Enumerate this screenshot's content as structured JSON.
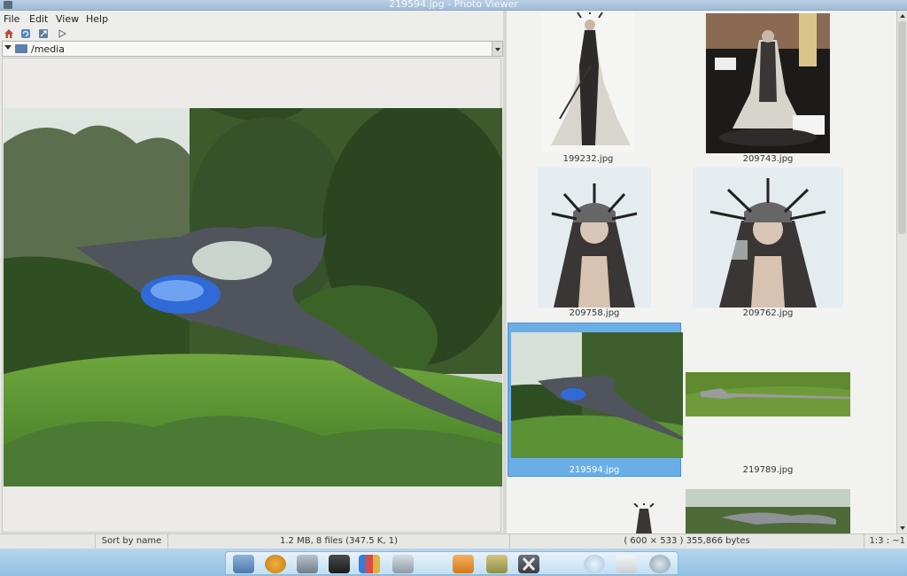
{
  "window": {
    "title": "219594.jpg - Photo Viewer"
  },
  "menu": [
    "File",
    "Edit",
    "View",
    "Help"
  ],
  "toolbar": {
    "icons": [
      "home-icon",
      "refresh-icon",
      "zoom-fit-icon",
      "play-icon"
    ]
  },
  "location": {
    "path": "/media"
  },
  "thumbnails": [
    {
      "name": "199232.jpg",
      "selected": false
    },
    {
      "name": "209743.jpg",
      "selected": false
    },
    {
      "name": "209758.jpg",
      "selected": false
    },
    {
      "name": "209762.jpg",
      "selected": false
    },
    {
      "name": "219594.jpg",
      "selected": true
    },
    {
      "name": "219789.jpg",
      "selected": false
    },
    {
      "name": "",
      "selected": false
    },
    {
      "name": "",
      "selected": false
    }
  ],
  "status": {
    "sort": "Sort by name",
    "summary": "1.2 MB, 8 files (347.5 K, 1)",
    "image_info": "( 600 × 533 ) 355,866 bytes",
    "zoom": "1:3 : ~1"
  },
  "dock": {
    "icons": [
      "pointer-icon",
      "help-icon",
      "skype-icon",
      "photos-icon",
      "folders-icon",
      "media-player-icon",
      "download-icon",
      "tools-icon",
      "close-app-icon",
      "globe-icon",
      "keyboard-icon",
      "camera-icon"
    ]
  }
}
